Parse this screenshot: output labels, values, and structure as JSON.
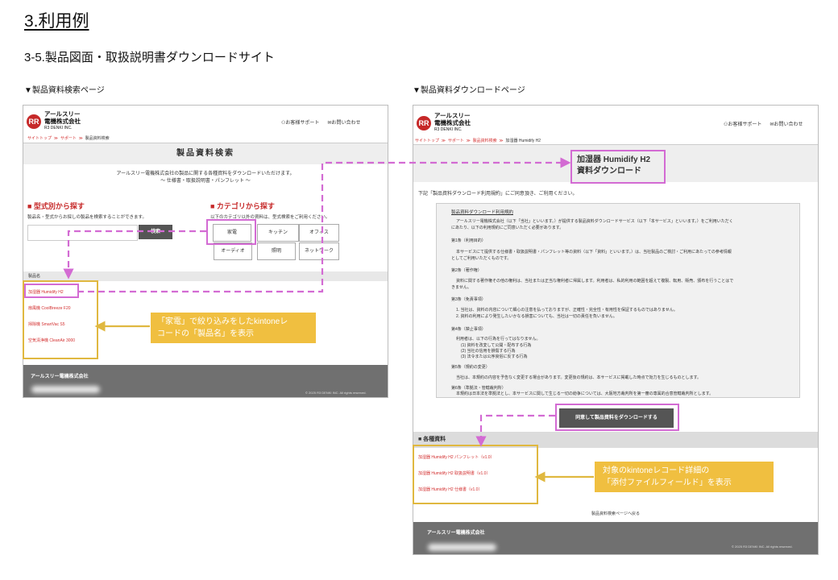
{
  "heading": "3.利用例",
  "subheading": "3-5.製品図面・取扱説明書ダウンロードサイト",
  "left_caption": "▼製品資料検索ページ",
  "right_caption": "▼製品資料ダウンロードページ",
  "company": {
    "logo_mark": "RR",
    "name_line1": "アールスリー",
    "name_line2": "電機株式会社",
    "name_en": "R3 DENKI INC."
  },
  "header_links": {
    "support": "お客様サポート",
    "contact": "お問い合わせ"
  },
  "search_page": {
    "breadcrumb": [
      "サイトトップ",
      "サポート",
      "製品資料検索"
    ],
    "title": "製品資料検索",
    "intro1": "アールスリー電機株式会社の製品に関する各種資料をダウンロードいただけます。",
    "intro2": "〜 仕様書・取扱説明書・パンフレット 〜",
    "model_title": "■ 型式別から探す",
    "model_text": "製品名・型式からお探しの製品を検索することができます。",
    "search_button": "検索",
    "category_title": "■ カテゴリから探す",
    "category_text": "以下のカテゴリ以外の資料は、型式検索をご利用ください。",
    "categories": [
      "家電",
      "キッチン",
      "オフィス",
      "オーディオ",
      "照明",
      "ネットワーク"
    ],
    "column_header": "製品名",
    "products": [
      "加湿器 Humidify H2",
      "扇風機 CoolBreeze F20",
      "掃除機 SmartVac S5",
      "空気清浄機 CleanAir 3000"
    ],
    "footer_name": "アールスリー電機株式会社",
    "footer_copy": "© 2025 R3 DENKI INC. All rights reserved."
  },
  "download_page": {
    "breadcrumb": [
      "サイトトップ",
      "サポート",
      "製品資料検索",
      "加湿器 Humidify H2"
    ],
    "title_line1": "加湿器 Humidify H2",
    "title_line2": "資料ダウンロード",
    "agree_lead": "下記「製品資料ダウンロード利用規約」にご同意頂き、ご利用ください。",
    "terms_title": "製品資料ダウンロード利用規約",
    "terms_lines": [
      "アールスリー電機株式会社（以下「当社」といいます。）が提供する製品資料ダウンロードサービス（以下「本サービス」といいます。）をご利用いただく",
      "にあたり、以下の利用規約にご同意いただく必要があります。",
      "第1条（利用目的）",
      "本サービスにて提供する仕様書・取扱説明書・パンフレット等の資料（以下「資料」といいます。）は、当社製品のご検討・ご利用にあたっての参考情報",
      "としてご利用いただくものです。",
      "第2条（著作権）",
      "資料に関する著作権その他の権利は、当社または正当な権利者に帰属します。利用者は、私的利用の範囲を超えて複製、転用、販売、頒布を行うことはで",
      "きません。",
      "第3条（免責事項）",
      "1. 当社は、資料の内容について細心の注意を払っておりますが、正確性・完全性・有用性を保証するものではありません。",
      "2. 資料の利用により発生したいかなる損害についても、当社は一切の責任を負いません。",
      "第4条（禁止事項）",
      "利用者は、以下の行為を行ってはなりません。",
      "(1) 資料を改変して公開・配布する行為",
      "(2) 当社の信用を損傷する行為",
      "(3) 法令または公序良俗に反する行為",
      "第5条（規約の変更）",
      "当社は、本規約の内容を予告なく変更する場合があります。変更後の規約は、本サービスに掲載した時点で効力を生じるものとします。",
      "第6条（準拠法・管轄裁判所）",
      "本規約は日本法を準拠法とし、本サービスに関して生じる一切の紛争については、大阪地方裁判所を第一審の専属的合意管轄裁判所とします。"
    ],
    "download_button": "同意して製品資料をダウンロードする",
    "docs_title": "■ 各種資料",
    "docs": [
      "加湿器 Humidify H2 パンフレット（v1.0）",
      "加湿器 Humidify H2 取扱説明書（v1.0）",
      "加湿器 Humidify H2 仕様書（v1.0）"
    ],
    "back_link": "製品資料検索ページへ戻る",
    "footer_name": "アールスリー電機株式会社",
    "footer_copy": "© 2025 R3 DENKI INC. All rights reserved."
  },
  "notes": {
    "left_line1": "「家電」で絞り込みをしたkintoneレ",
    "left_line2": "コードの「製品名」を表示",
    "right_line1": "対象のkintoneレコード詳細の",
    "right_line2": "「添付ファイルフィールド」を表示"
  },
  "colors": {
    "brand_red": "#c62828",
    "link_red": "#d32f2f",
    "note_yellow": "#f0bf40",
    "arrow_magenta": "#d36bd3"
  }
}
